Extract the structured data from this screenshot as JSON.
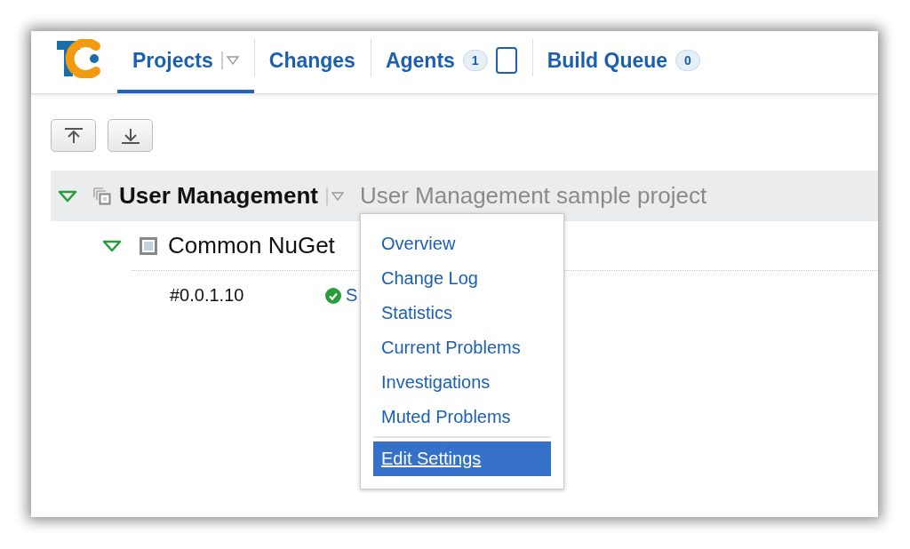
{
  "header": {
    "tabs": [
      {
        "label": "Projects",
        "selected": true,
        "dropdown": true
      },
      {
        "label": "Changes",
        "selected": false,
        "dropdown": false
      },
      {
        "label": "Agents",
        "selected": false,
        "dropdown": false,
        "badge": "1",
        "device_icon": true
      },
      {
        "label": "Build Queue",
        "selected": false,
        "dropdown": false,
        "badge": "0"
      }
    ]
  },
  "project": {
    "name": "User Management",
    "description": "User Management sample project",
    "expanded": true,
    "build_configuration": {
      "name": "Common NuGet",
      "expanded": true,
      "build": {
        "number": "#0.0.1.10",
        "kind": "success",
        "status_text": "S"
      }
    }
  },
  "menu": {
    "items": [
      {
        "label": "Overview",
        "selected": false
      },
      {
        "label": "Change Log",
        "selected": false
      },
      {
        "label": "Statistics",
        "selected": false
      },
      {
        "label": "Current Problems",
        "selected": false
      },
      {
        "label": "Investigations",
        "selected": false
      },
      {
        "label": "Muted Problems",
        "selected": false
      },
      {
        "label": "Edit Settings",
        "selected": true,
        "separator_before": true
      }
    ]
  }
}
